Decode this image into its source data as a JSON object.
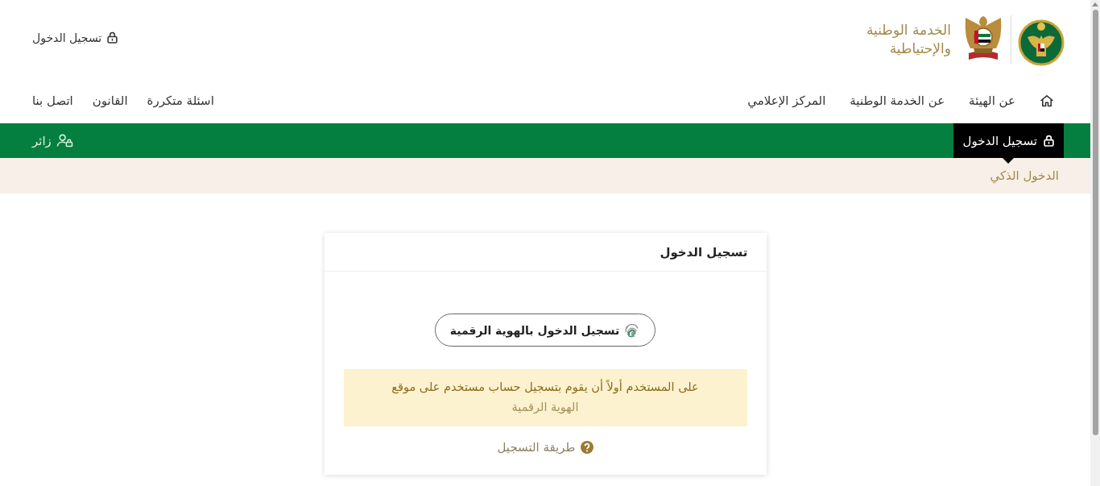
{
  "header": {
    "organization_name": [
      "الخدمة الوطنية",
      "والإحتياطية"
    ],
    "login_link": "تسجيل الدخول"
  },
  "nav": {
    "main_links": [
      "عن الهيئة",
      "عن الخدمة الوطنية",
      "المركز الإعلامي"
    ],
    "secondary_links": [
      "اسئلة متكررة",
      "القانون",
      "اتصل بنا"
    ]
  },
  "menu_bar": {
    "tabs": [
      {
        "label": "تسجيل الدخول",
        "selected": true
      }
    ],
    "visitor": "زائر"
  },
  "submenu": {
    "items": [
      "الدخول الذكي"
    ]
  },
  "card": {
    "title": "تسجيل الدخول",
    "digital_id_button": "تسجيل الدخول بالهوية الرقمية",
    "notice": {
      "text": "على المستخدم أولاً أن يقوم بتسجيل حساب مستخدم على موقع",
      "link": "الهوية الرقمية"
    },
    "help_link": "طريقة التسجيل"
  }
}
